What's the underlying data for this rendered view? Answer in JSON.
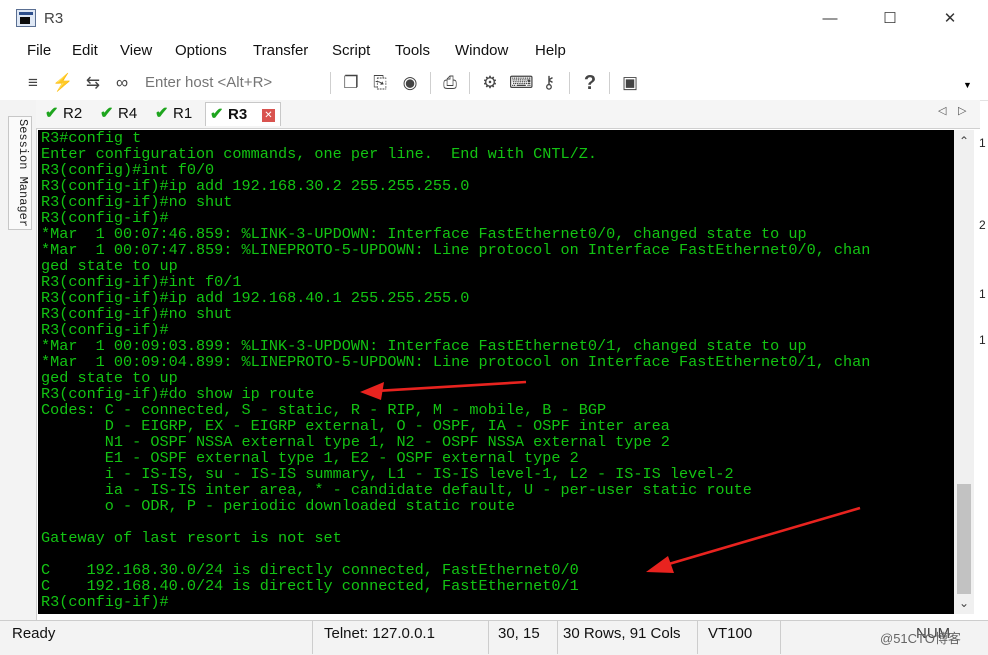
{
  "window": {
    "title": "R3"
  },
  "menu": [
    "File",
    "Edit",
    "View",
    "Options",
    "Transfer",
    "Script",
    "Tools",
    "Window",
    "Help"
  ],
  "toolbar": {
    "host_placeholder": "Enter host <Alt+R>"
  },
  "session_manager": {
    "label": "Session Manager"
  },
  "tabs": [
    {
      "label": "R2",
      "status": "connected"
    },
    {
      "label": "R4",
      "status": "connected"
    },
    {
      "label": "R1",
      "status": "connected"
    },
    {
      "label": "R3",
      "status": "connected",
      "active": true
    }
  ],
  "terminal": {
    "lines": [
      "R3#config t",
      "Enter configuration commands, one per line.  End with CNTL/Z.",
      "R3(config)#int f0/0",
      "R3(config-if)#ip add 192.168.30.2 255.255.255.0",
      "R3(config-if)#no shut",
      "R3(config-if)#",
      "*Mar  1 00:07:46.859: %LINK-3-UPDOWN: Interface FastEthernet0/0, changed state to up",
      "*Mar  1 00:07:47.859: %LINEPROTO-5-UPDOWN: Line protocol on Interface FastEthernet0/0, chan",
      "ged state to up",
      "R3(config-if)#int f0/1",
      "R3(config-if)#ip add 192.168.40.1 255.255.255.0",
      "R3(config-if)#no shut",
      "R3(config-if)#",
      "*Mar  1 00:09:03.899: %LINK-3-UPDOWN: Interface FastEthernet0/1, changed state to up",
      "*Mar  1 00:09:04.899: %LINEPROTO-5-UPDOWN: Line protocol on Interface FastEthernet0/1, chan",
      "ged state to up",
      "R3(config-if)#do show ip route",
      "Codes: C - connected, S - static, R - RIP, M - mobile, B - BGP",
      "       D - EIGRP, EX - EIGRP external, O - OSPF, IA - OSPF inter area",
      "       N1 - OSPF NSSA external type 1, N2 - OSPF NSSA external type 2",
      "       E1 - OSPF external type 1, E2 - OSPF external type 2",
      "       i - IS-IS, su - IS-IS summary, L1 - IS-IS level-1, L2 - IS-IS level-2",
      "       ia - IS-IS inter area, * - candidate default, U - per-user static route",
      "       o - ODR, P - periodic downloaded static route",
      "",
      "Gateway of last resort is not set",
      "",
      "C    192.168.30.0/24 is directly connected, FastEthernet0/0",
      "C    192.168.40.0/24 is directly connected, FastEthernet0/1",
      "R3(config-if)#"
    ],
    "text_color": "#13c413",
    "background": "#000000"
  },
  "status": {
    "state": "Ready",
    "connection": "Telnet: 127.0.0.1",
    "cursor": "30, 15",
    "size": "30 Rows, 91 Cols",
    "emulation": "VT100",
    "caps": "NUM"
  },
  "watermark": "@51CTO博客",
  "edge_fragments": [
    "1",
    "2",
    "1",
    "1"
  ],
  "annotation_color": "#e8231f"
}
